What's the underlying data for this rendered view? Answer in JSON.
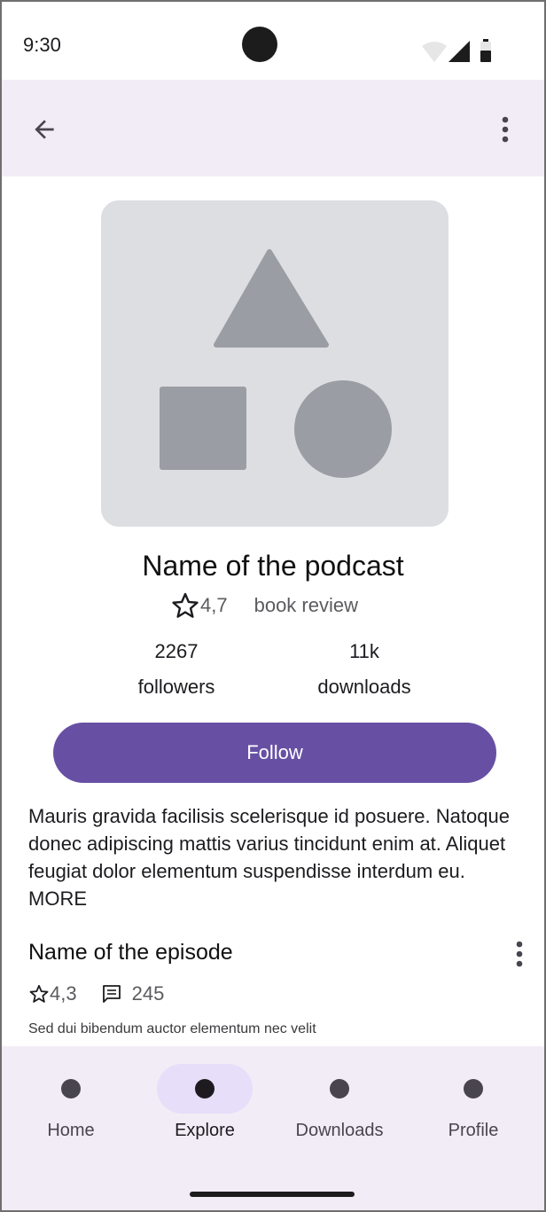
{
  "status_bar": {
    "time": "9:30"
  },
  "podcast": {
    "title": "Name of the podcast",
    "rating": "4,7",
    "genre": "book review",
    "followers_count": "2267",
    "followers_label": "followers",
    "downloads_count": "11k",
    "downloads_label": "downloads",
    "follow_label": "Follow",
    "description": "Mauris gravida facilisis scelerisque id posuere. Natoque donec adipiscing mattis varius tincidunt enim at. Aliquet feugiat dolor elementum suspendisse interdum eu. MORE"
  },
  "episode": {
    "title": "Name of the episode",
    "rating": "4,3",
    "comments": "245",
    "description": "Sed dui bibendum auctor elementum nec velit"
  },
  "bottom_nav": {
    "items": [
      {
        "label": "Home",
        "active": false
      },
      {
        "label": "Explore",
        "active": true
      },
      {
        "label": "Downloads",
        "active": false
      },
      {
        "label": "Profile",
        "active": false
      }
    ]
  },
  "colors": {
    "accent": "#6750a4",
    "surface_tint": "#f2ecf6",
    "placeholder_bg": "#dddee2",
    "placeholder_shape": "#9a9ea4"
  },
  "icons": [
    "back-arrow-icon",
    "more-vert-icon",
    "star-outline-icon",
    "comment-icon",
    "wifi-icon",
    "signal-icon",
    "battery-icon"
  ]
}
